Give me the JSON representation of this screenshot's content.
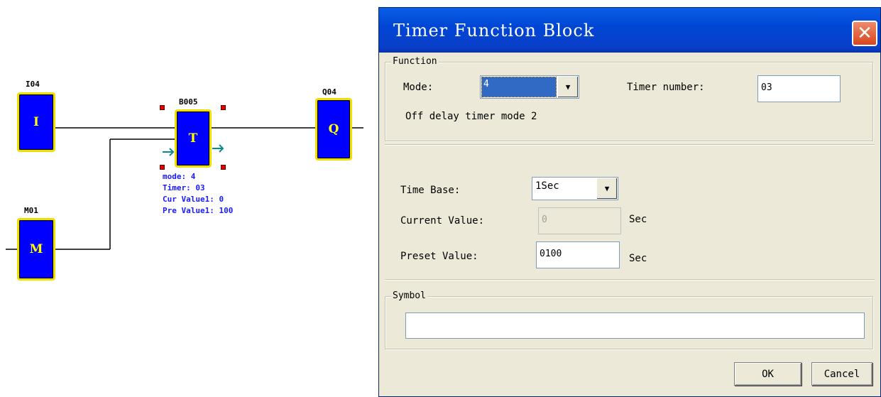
{
  "diagram": {
    "blocks": [
      {
        "label": "I04",
        "letter": "I"
      },
      {
        "label": "M01",
        "letter": "M"
      },
      {
        "label": "B005",
        "letter": "T"
      },
      {
        "label": "Q04",
        "letter": "Q"
      }
    ],
    "info": {
      "mode": "mode: 4",
      "timer": "Timer: 03",
      "cur": "Cur Value1: 0",
      "pre": "Pre Value1: 100"
    }
  },
  "dialog": {
    "title": "Timer Function Block",
    "function_group": {
      "title": "Function",
      "mode_label": "Mode:",
      "mode_value": "4",
      "timer_number_label": "Timer number:",
      "timer_number_value": "03",
      "mode_description": "Off delay timer mode 2"
    },
    "time_base_label": "Time Base:",
    "time_base_value": "1Sec",
    "current_value_label": "Current Value:",
    "current_value": "0",
    "current_unit": "Sec",
    "preset_value_label": "Preset Value:",
    "preset_value": "0100",
    "preset_unit": "Sec",
    "symbol_group": {
      "title": "Symbol",
      "value": ""
    },
    "ok_label": "OK",
    "cancel_label": "Cancel"
  },
  "colors": {
    "block_fill": "#0000ff",
    "block_border": "#f0e000",
    "titlebar": "#0046d5",
    "dialog_bg": "#ece9d8"
  }
}
